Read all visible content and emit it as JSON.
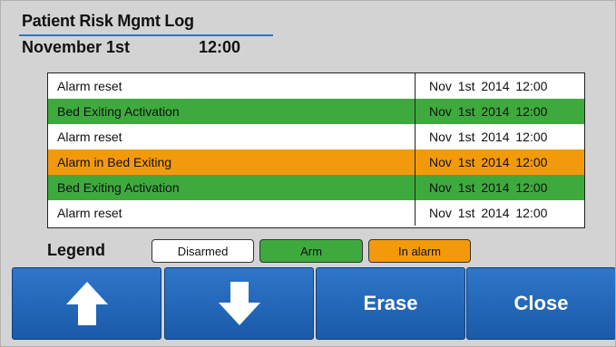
{
  "header": {
    "title": "Patient Risk Mgmt Log",
    "date": "November 1st",
    "time": "12:00"
  },
  "log": {
    "rows": [
      {
        "event": "Alarm reset",
        "timestamp": "Nov 1st 2014 12:00",
        "status": "disarmed"
      },
      {
        "event": "Bed Exiting Activation",
        "timestamp": "Nov 1st 2014 12:00",
        "status": "arm"
      },
      {
        "event": "Alarm reset",
        "timestamp": "Nov 1st 2014 12:00",
        "status": "disarmed"
      },
      {
        "event": "Alarm in Bed Exiting",
        "timestamp": "Nov 1st 2014 12:00",
        "status": "in_alarm"
      },
      {
        "event": "Bed Exiting Activation",
        "timestamp": "Nov 1st 2014 12:00",
        "status": "arm"
      },
      {
        "event": "Alarm reset",
        "timestamp": "Nov 1st 2014 12:00",
        "status": "disarmed"
      }
    ]
  },
  "legend": {
    "label": "Legend",
    "disarmed": "Disarmed",
    "arm": "Arm",
    "in_alarm": "In alarm"
  },
  "buttons": {
    "up_icon": "arrow-up-icon",
    "down_icon": "arrow-down-icon",
    "erase": "Erase",
    "close": "Close"
  },
  "colors": {
    "disarmed": "#ffffff",
    "arm": "#3eaa3e",
    "in_alarm": "#f39a0c",
    "button": "#2466b8",
    "title_rule": "#2f73c4"
  }
}
